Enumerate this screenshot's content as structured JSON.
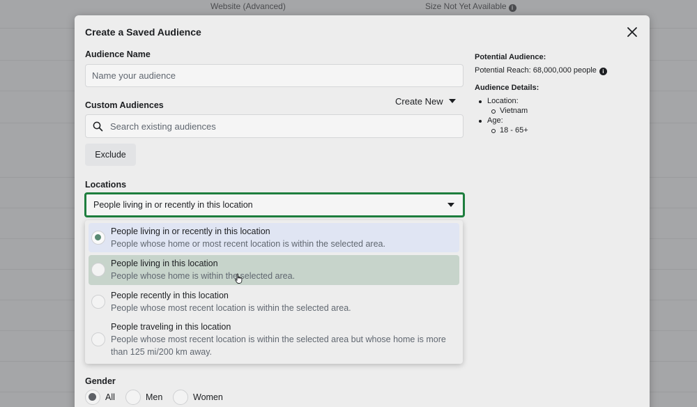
{
  "background": {
    "column_website": "Website (Advanced)",
    "column_size": "Size Not Yet Available"
  },
  "modal": {
    "title": "Create a Saved Audience",
    "audience_name": {
      "label": "Audience Name",
      "placeholder": "Name your audience",
      "value": ""
    },
    "custom_audiences": {
      "label": "Custom Audiences",
      "create_new_label": "Create New",
      "search_placeholder": "Search existing audiences",
      "exclude_label": "Exclude"
    },
    "locations": {
      "label": "Locations",
      "selected": "People living in or recently in this location",
      "options": [
        {
          "title": "People living in or recently in this location",
          "description": "People whose home or most recent location is within the selected area.",
          "state": "selected"
        },
        {
          "title": "People living in this location",
          "description": "People whose home is within the selected area.",
          "state": "hovered"
        },
        {
          "title": "People recently in this location",
          "description": "People whose most recent location is within the selected area.",
          "state": "normal"
        },
        {
          "title": "People traveling in this location",
          "description": "People whose most recent location is within the selected area but whose home is more than 125 mi/200 km away.",
          "state": "normal"
        }
      ]
    },
    "gender": {
      "label": "Gender",
      "options": [
        "All",
        "Men",
        "Women"
      ],
      "selected": "All"
    }
  },
  "summary": {
    "potential_audience_heading": "Potential Audience:",
    "potential_reach": "Potential Reach: 68,000,000 people",
    "audience_details_heading": "Audience Details:",
    "details": [
      {
        "label": "Location:",
        "values": [
          "Vietnam"
        ]
      },
      {
        "label": "Age:",
        "values": [
          "18 - 65+"
        ]
      }
    ]
  },
  "colors": {
    "focus_border": "#1e7e3e",
    "selected_option_bg": "#e0e5f3",
    "hovered_option_bg": "#c7d4cb"
  }
}
